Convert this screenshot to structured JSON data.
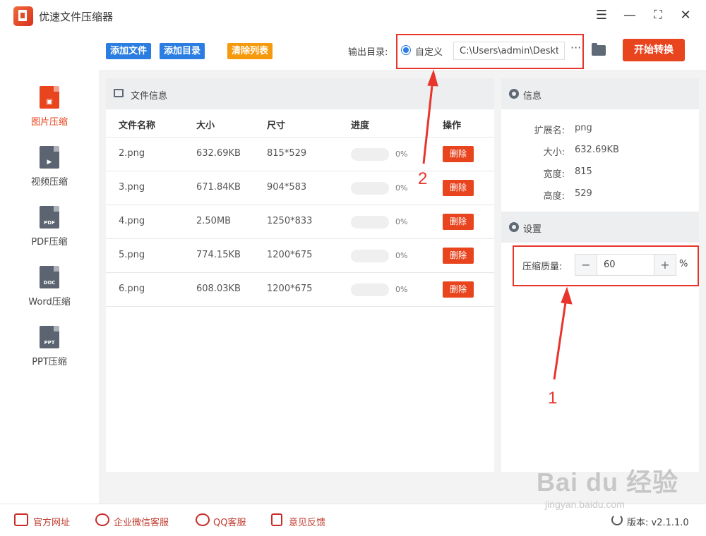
{
  "app": {
    "title": "优速文件压缩器"
  },
  "window": {
    "menu_icon": "menu-icon",
    "minimize_icon": "minimize-icon",
    "maximize_icon": "maximize-icon",
    "close_icon": "close-icon"
  },
  "sidebar": {
    "items": [
      {
        "label": "图片压缩",
        "icon_text": "",
        "active": true
      },
      {
        "label": "视频压缩",
        "icon_text": "▶",
        "active": false
      },
      {
        "label": "PDF压缩",
        "icon_text": "PDF",
        "active": false
      },
      {
        "label": "Word压缩",
        "icon_text": "DOC",
        "active": false
      },
      {
        "label": "PPT压缩",
        "icon_text": "PPT",
        "active": false
      }
    ]
  },
  "toolbar": {
    "add_file": "添加文件",
    "add_dir": "添加目录",
    "clear_list": "清除列表",
    "output_label": "输出目录:",
    "radio_label": "自定义",
    "output_path": "C:\\Users\\admin\\Deskto",
    "more": "···",
    "start": "开始转换"
  },
  "file_panel": {
    "title": "文件信息",
    "headers": {
      "name": "文件名称",
      "size": "大小",
      "dim": "尺寸",
      "progress": "进度",
      "action": "操作"
    },
    "rows": [
      {
        "name": "2.png",
        "size": "632.69KB",
        "dim": "815*529",
        "progress": "0%",
        "action": "删除"
      },
      {
        "name": "3.png",
        "size": "671.84KB",
        "dim": "904*583",
        "progress": "0%",
        "action": "删除"
      },
      {
        "name": "4.png",
        "size": "2.50MB",
        "dim": "1250*833",
        "progress": "0%",
        "action": "删除"
      },
      {
        "name": "5.png",
        "size": "774.15KB",
        "dim": "1200*675",
        "progress": "0%",
        "action": "删除"
      },
      {
        "name": "6.png",
        "size": "608.03KB",
        "dim": "1200*675",
        "progress": "0%",
        "action": "删除"
      }
    ]
  },
  "info_panel": {
    "title": "信息",
    "ext_label": "扩展名:",
    "ext": "png",
    "size_label": "大小:",
    "size": "632.69KB",
    "width_label": "宽度:",
    "width": "815",
    "height_label": "高度:",
    "height": "529"
  },
  "settings": {
    "title": "设置",
    "quality_label": "压缩质量:",
    "minus": "−",
    "quality": "60",
    "plus": "+",
    "unit": "%"
  },
  "annotations": {
    "one": "1",
    "two": "2"
  },
  "statusbar": {
    "website": "官方网址",
    "wechat": "企业微信客服",
    "qq": "QQ客服",
    "feedback": "意见反馈",
    "version": "版本: v2.1.1.0"
  },
  "watermark": {
    "brand": "Bai du 经验",
    "url": "jingyan.baidu.com"
  },
  "colors": {
    "accent": "#e8451f",
    "blue": "#2b7de1",
    "orange": "#f59a0c",
    "annotation": "#e8352c"
  }
}
